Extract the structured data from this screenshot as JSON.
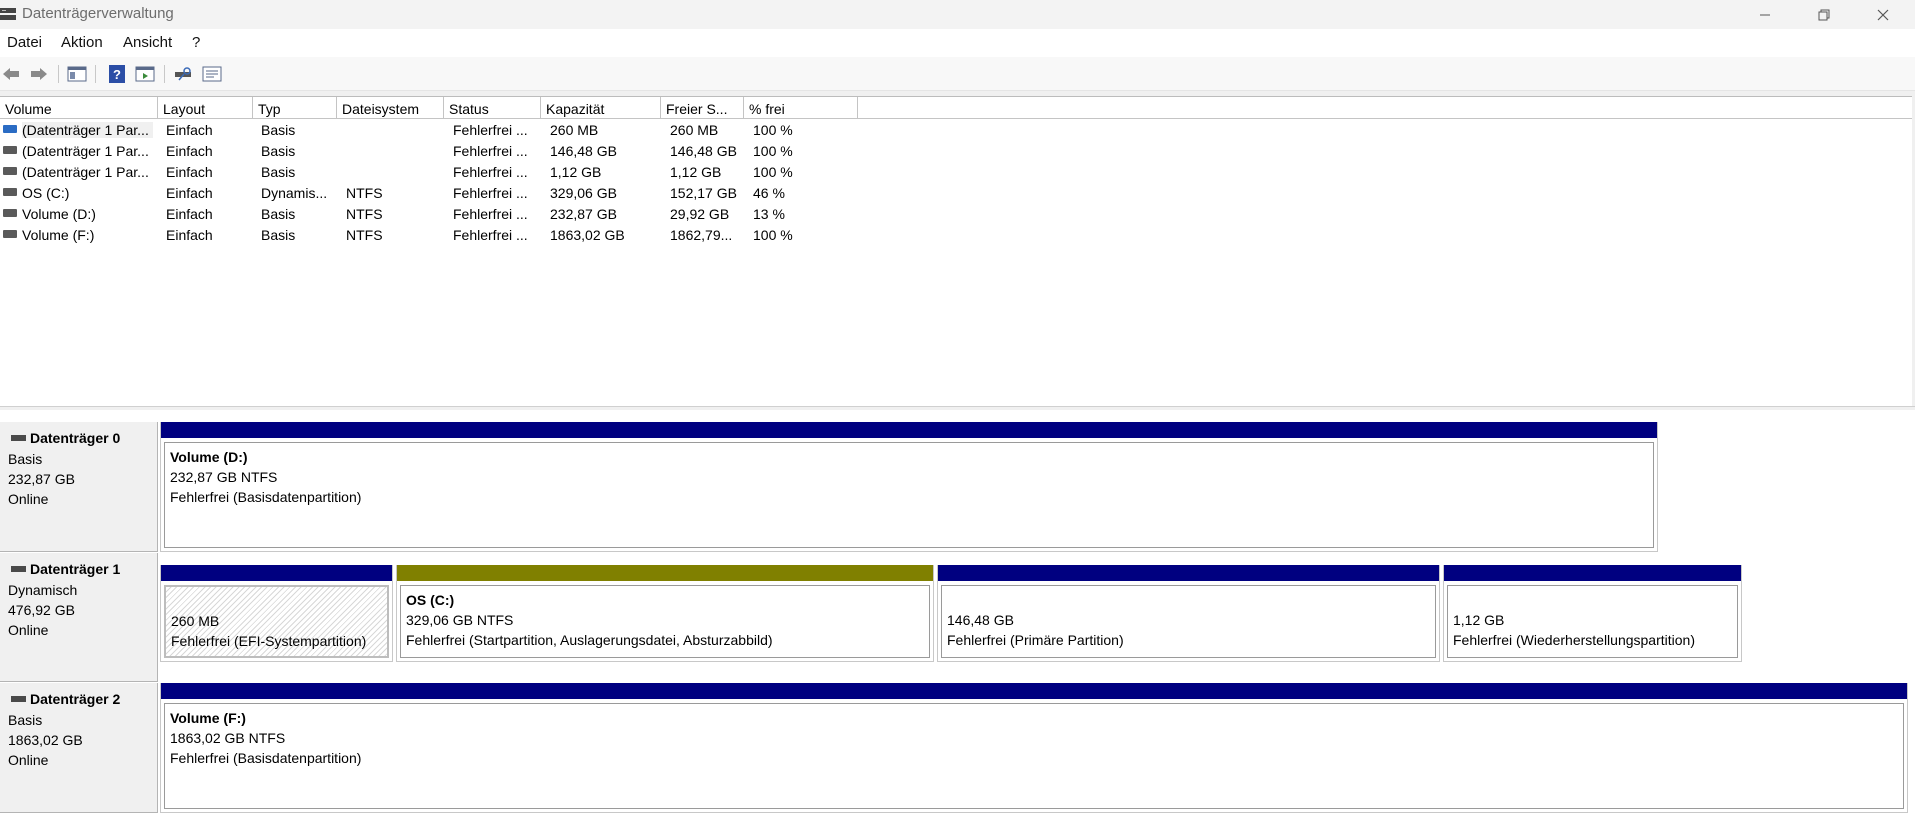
{
  "window": {
    "title": "Datenträgerverwaltung"
  },
  "menu": [
    "Datei",
    "Aktion",
    "Ansicht",
    "?"
  ],
  "toolbar_icons": [
    "back-icon",
    "forward-icon",
    "console-tree-icon",
    "help-icon",
    "action-pane-icon",
    "connect-icon",
    "properties-icon"
  ],
  "columns": [
    "Volume",
    "Layout",
    "Typ",
    "Dateisystem",
    "Status",
    "Kapazität",
    "Freier S...",
    "% frei"
  ],
  "rows": [
    [
      "(Datenträger 1 Par...",
      "Einfach",
      "Basis",
      "",
      "Fehlerfrei ...",
      "260 MB",
      "260 MB",
      "100 %"
    ],
    [
      "(Datenträger 1 Par...",
      "Einfach",
      "Basis",
      "",
      "Fehlerfrei ...",
      "146,48 GB",
      "146,48 GB",
      "100 %"
    ],
    [
      "(Datenträger 1 Par...",
      "Einfach",
      "Basis",
      "",
      "Fehlerfrei ...",
      "1,12 GB",
      "1,12 GB",
      "100 %"
    ],
    [
      "OS (C:)",
      "Einfach",
      "Dynamis...",
      "NTFS",
      "Fehlerfrei ...",
      "329,06 GB",
      "152,17 GB",
      "46 %"
    ],
    [
      "Volume (D:)",
      "Einfach",
      "Basis",
      "NTFS",
      "Fehlerfrei ...",
      "232,87 GB",
      "29,92 GB",
      "13 %"
    ],
    [
      "Volume (F:)",
      "Einfach",
      "Basis",
      "NTFS",
      "Fehlerfrei ...",
      "1863,02 GB",
      "1862,79...",
      "100 %"
    ]
  ],
  "disks": [
    {
      "name": "Datenträger 0",
      "type": "Basis",
      "size": "232,87 GB",
      "state": "Online",
      "partitions": [
        {
          "name": "Volume  (D:)",
          "detail": "232,87 GB NTFS",
          "status": "Fehlerfrei (Basisdatenpartition)",
          "bar_color": "#000080",
          "hatched": false
        }
      ]
    },
    {
      "name": "Datenträger 1",
      "type": "Dynamisch",
      "size": "476,92 GB",
      "state": "Online",
      "partitions": [
        {
          "name": "",
          "detail": "260 MB",
          "status": "Fehlerfrei (EFI-Systempartition)",
          "bar_color": "#000080",
          "hatched": true
        },
        {
          "name": "OS  (C:)",
          "detail": "329,06 GB NTFS",
          "status": "Fehlerfrei (Startpartition, Auslagerungsdatei, Absturzabbild)",
          "bar_color": "#808000",
          "hatched": false
        },
        {
          "name": "",
          "detail": "146,48 GB",
          "status": "Fehlerfrei (Primäre Partition)",
          "bar_color": "#000080",
          "hatched": false
        },
        {
          "name": "",
          "detail": "1,12 GB",
          "status": "Fehlerfrei (Wiederherstellungspartition)",
          "bar_color": "#000080",
          "hatched": false
        }
      ]
    },
    {
      "name": "Datenträger 2",
      "type": "Basis",
      "size": "1863,02 GB",
      "state": "Online",
      "partitions": [
        {
          "name": "Volume  (F:)",
          "detail": "1863,02 GB NTFS",
          "status": "Fehlerfrei (Basisdatenpartition)",
          "bar_color": "#000080",
          "hatched": false
        }
      ]
    }
  ]
}
